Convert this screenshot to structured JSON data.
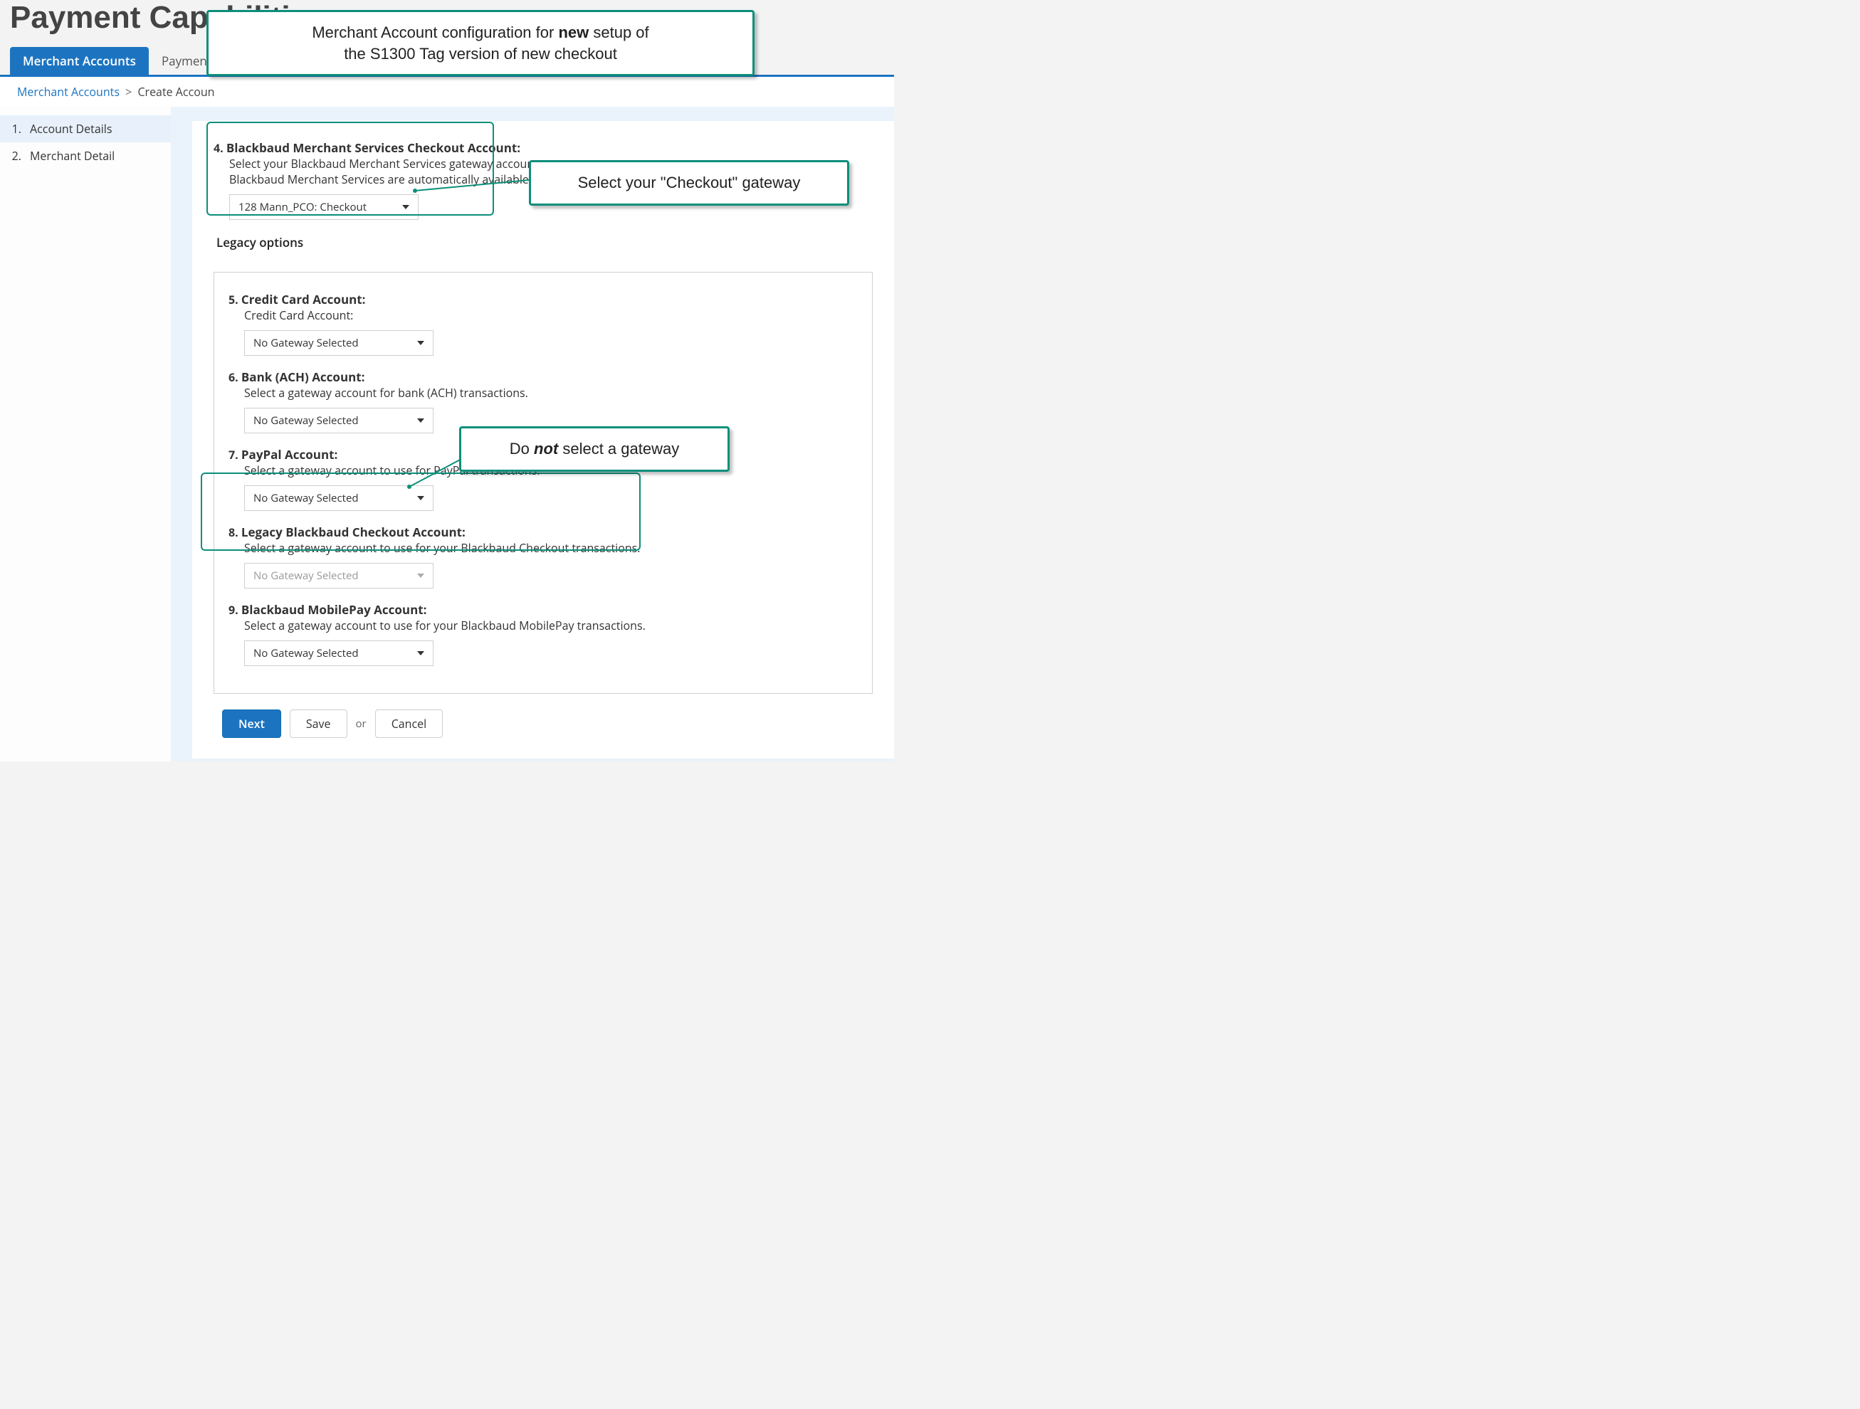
{
  "page_title": "Payment Capabilities",
  "tabs": [
    {
      "label": "Merchant Accounts",
      "active": true
    },
    {
      "label": "Payment",
      "active": false
    }
  ],
  "breadcrumb": {
    "link": "Merchant Accounts",
    "sep": ">",
    "current": "Create Accoun"
  },
  "sidebar": {
    "items": [
      {
        "num": "1.",
        "label": "Account Details",
        "selected": true
      },
      {
        "num": "2.",
        "label": "Merchant Detail",
        "selected": false
      }
    ]
  },
  "annotations": {
    "top": {
      "line1_pre": "Merchant Account configuration for ",
      "line1_bold": "new",
      "line1_post": " setup of",
      "line2": "the S1300 Tag version of new checkout"
    },
    "right1": "Select your \"Checkout\" gateway",
    "right2_pre": "Do ",
    "right2_italic": "not",
    "right2_post": " select a gateway"
  },
  "fields": {
    "f4": {
      "num": "4.",
      "title": "Blackbaud Merchant Services Checkout Account:",
      "desc1": "Select your Blackbaud Merchant Services gateway account",
      "desc2": "Blackbaud Merchant Services are automatically available i",
      "select_value": "128 Mann_PCO: Checkout"
    },
    "legacy_title": "Legacy options",
    "f5": {
      "num": "5.",
      "title": "Credit Card Account:",
      "desc": "Credit Card Account:",
      "select_value": "No Gateway Selected"
    },
    "f6": {
      "num": "6.",
      "title": "Bank (ACH) Account:",
      "desc": "Select a gateway account for bank (ACH) transactions.",
      "select_value": "No Gateway Selected"
    },
    "f7": {
      "num": "7.",
      "title": "PayPal Account:",
      "desc": "Select a gateway account to use for PayPal transactions.",
      "select_value": "No Gateway Selected"
    },
    "f8": {
      "num": "8.",
      "title": "Legacy Blackbaud Checkout Account:",
      "desc": "Select a gateway account to use for your Blackbaud Checkout transactions.",
      "select_value": "No Gateway Selected"
    },
    "f9": {
      "num": "9.",
      "title": "Blackbaud MobilePay Account:",
      "desc": "Select a gateway account to use for your Blackbaud MobilePay transactions.",
      "select_value": "No Gateway Selected"
    }
  },
  "actions": {
    "next": "Next",
    "save": "Save",
    "or": "or",
    "cancel": "Cancel"
  }
}
